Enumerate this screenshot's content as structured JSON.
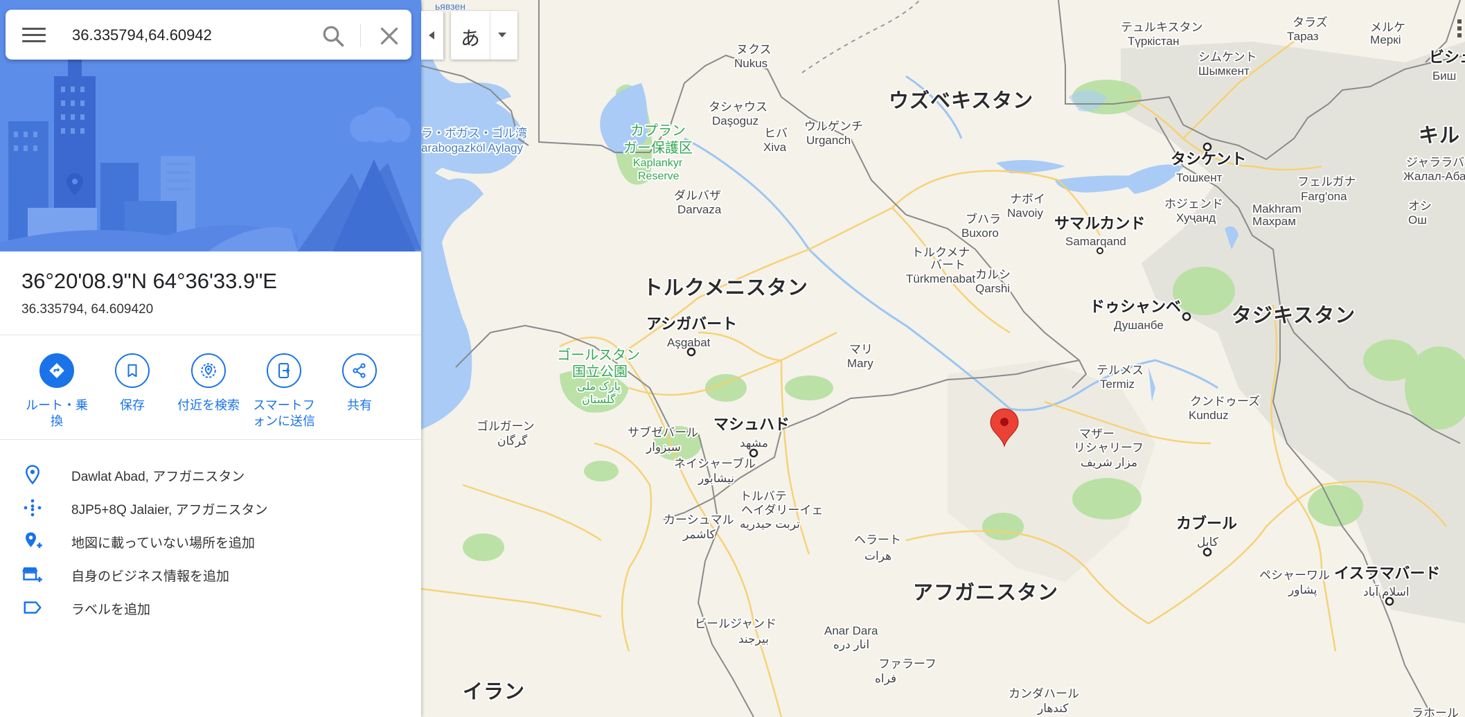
{
  "search": {
    "value": "36.335794,64.60942"
  },
  "ime": {
    "label": "あ"
  },
  "place": {
    "title": "36°20'08.9\"N 64°36'33.9\"E",
    "subtitle": "36.335794, 64.609420"
  },
  "actions": [
    {
      "label": "ルート・乗換"
    },
    {
      "label": "保存"
    },
    {
      "label": "付近を検索"
    },
    {
      "label": "スマートフォンに送信"
    },
    {
      "label": "共有"
    }
  ],
  "info": [
    {
      "text": "Dawlat Abad, アフガニスタン"
    },
    {
      "text": "8JP5+8Q Jalaier, アフガニスタン"
    },
    {
      "text": "地図に載っていない場所を追加"
    },
    {
      "text": "自身のビジネス情報を追加"
    },
    {
      "text": "ラベルを追加"
    }
  ],
  "colors": {
    "accent": "#1a73e8",
    "marker": "#ea4335",
    "hero": "#5a8be8"
  },
  "map": {
    "countries": {
      "uzbekistan": "ウズベキスタン",
      "turkmenistan": "トルクメニスタン",
      "tajikistan": "タジキスタン",
      "afghanistan": "アフガニスタン",
      "iran": "イラン",
      "kyrgyz": "キル"
    },
    "cities": {
      "ashgabat_jp": "アシガバート",
      "ashgabat": "Aşgabat",
      "mashhad_jp": "マシュハド",
      "mashhad": "مشهد",
      "samarkand_jp": "サマルカンド",
      "samarkand": "Samarqand",
      "tashkent_jp": "タシケント",
      "tashkent": "Тошкент",
      "dushanbe_jp": "ドゥシャンベ",
      "dushanbe": "Душанбе",
      "kabul_jp": "カブール",
      "kabul": "کابل",
      "islamabad_jp": "イスラマバード",
      "islamabad": "اسلام آباد",
      "bishkek_jp": "ビシュ",
      "bishkek": "Биш"
    },
    "towns": {
      "nukus_jp": "ヌクス",
      "nukus": "Nukus",
      "dashoguz_jp": "タシャウス",
      "dashoguz": "Daşoguz",
      "khiva_jp": "ヒバ",
      "khiva": "Xiva",
      "urgench_jp": "ウルゲンチ",
      "urgench": "Urganch",
      "darvaza_jp": "ダルバザ",
      "darvaza": "Darvaza",
      "navoiy_jp": "ナボイ",
      "navoiy": "Navoiy",
      "bukhara_jp": "ブハラ",
      "bukhara": "Buxoro",
      "turkmenabat_jp1": "トルクメナ",
      "turkmenabat_jp2": "バート",
      "turkmenabat": "Türkmenabat",
      "qarshi_jp": "カルシ",
      "qarshi": "Qarshi",
      "mary_jp": "マリ",
      "mary": "Mary",
      "termez_jp": "テルメス",
      "termez": "Termiz",
      "kunduz_jp": "クンドゥーズ",
      "kunduz": "Kunduz",
      "mazar_jp1": "マザー",
      "mazar_jp2": "リシャリーフ",
      "mazar": "مزار شريف",
      "herat_jp": "ヘラート",
      "herat": "هرات",
      "sabzevar_jp": "サブゼバール",
      "sabzevar": "سبزوار",
      "neyshabur_jp": "ネイシャーブル",
      "neyshabur": "نيشابور",
      "torbat_jp1": "トルバテ",
      "torbat_jp2": "ヘイダリーイェ",
      "torbat": "تربت حيدريه",
      "kashmar_jp": "カーシュマル",
      "kashmar": "کاشمر",
      "gorgan_jp": "ゴルガーン",
      "gorgan": "گرگان",
      "birjand_jp": "ビールジャンド",
      "birjand": "بیرجند",
      "anardara": "Anar Dara",
      "anardara_fa": "انار دره",
      "farah_jp": "ファラーフ",
      "farah": "فراه",
      "kandahar_jp": "カンダハール",
      "kandahar": "کندهار",
      "peshawar_jp": "ペシャーワル",
      "peshawar": "پشاور",
      "shymkent_jp": "シムケント",
      "shymkent": "Шымкент",
      "turkistan_jp": "テュルキスタン",
      "turkistan": "Түркістан",
      "taraz_jp": "タラズ",
      "taraz": "Тараз",
      "merki_jp": "メルケ",
      "merki": "Меркі",
      "fergana_jp": "フェルガナ",
      "fergana": "Farg'ona",
      "khujand_jp": "ホジェンド",
      "khujand": "Хуҷанд",
      "makhram": "Makhram",
      "makhram_ru": "Махрам",
      "jalalabad_jp": "ジャララバード",
      "jalalabad": "Жалал-Абад",
      "osh_jp": "オシ",
      "osh": "Ош",
      "lahore_jp": "ラホール"
    },
    "parks": {
      "kaplankyr_jp1": "カプラン",
      "kaplankyr_jp2": "ガー保護区",
      "kaplankyr_1": "Kaplankyr",
      "kaplankyr_2": "Reserve",
      "golestan_jp1": "ゴールスタン",
      "golestan_jp2": "国立公園",
      "golestan_fa1": "پارک ملی",
      "golestan_fa2": "گلستان"
    },
    "water": {
      "garabogaz_jp": "ラ・ボガス・ゴル湾",
      "garabogaz": "arabogazköl Aylagy",
      "top_left": "ьявзен"
    }
  }
}
